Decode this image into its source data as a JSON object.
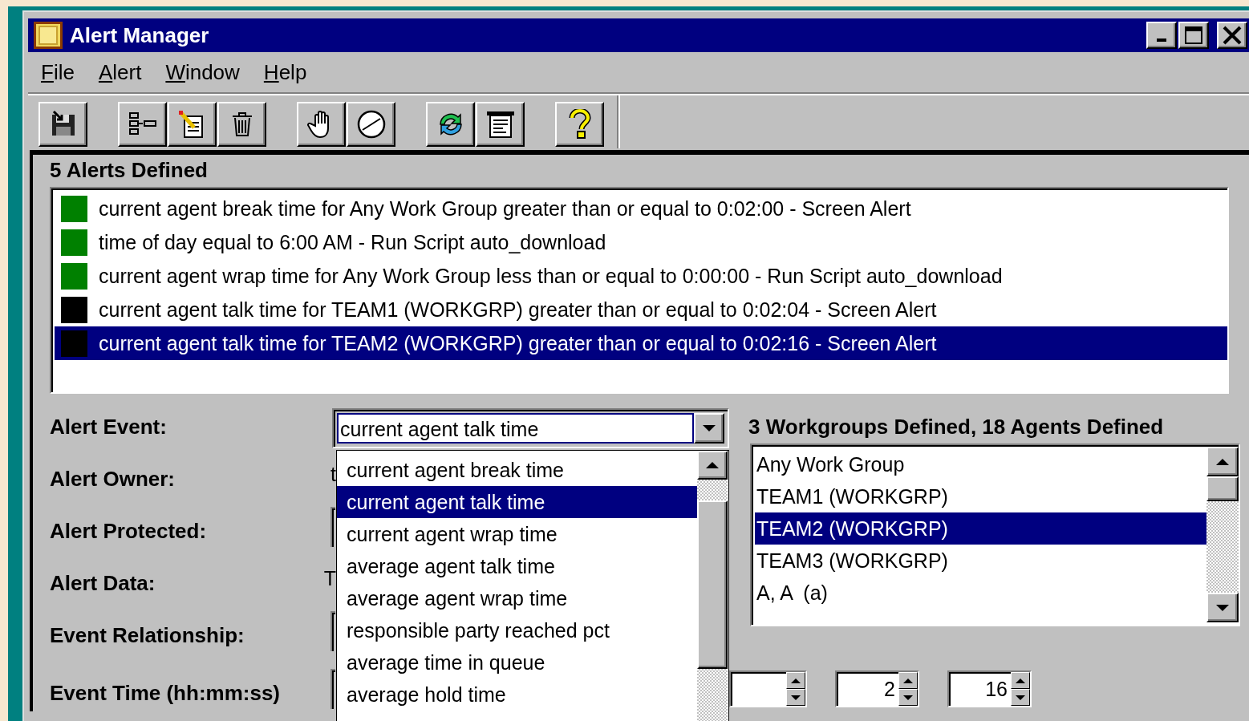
{
  "window": {
    "title": "Alert Manager"
  },
  "menu": [
    "File",
    "Alert",
    "Window",
    "Help"
  ],
  "alerts": {
    "heading": "5 Alerts Defined",
    "items": [
      {
        "text": "current agent break time for Any Work Group greater than or equal to 0:02:00 - Screen Alert",
        "color": "#008000",
        "selected": false
      },
      {
        "text": "time of day equal to 6:00 AM - Run Script auto_download",
        "color": "#008000",
        "selected": false
      },
      {
        "text": "current agent wrap time for Any Work Group less than or equal to 0:00:00 - Run Script auto_download",
        "color": "#008000",
        "selected": false
      },
      {
        "text": "current agent talk time for TEAM1 (WORKGRP) greater than or equal to 0:02:04 - Screen Alert",
        "color": "#000000",
        "selected": false
      },
      {
        "text": "current agent talk time for TEAM2 (WORKGRP) greater than or equal to 0:02:16 - Screen Alert",
        "color": "#000000",
        "selected": true
      }
    ]
  },
  "form": {
    "fields": [
      {
        "label": "Alert Event:",
        "kind": "combo",
        "value": "current agent talk time"
      },
      {
        "label": "Alert Owner:",
        "kind": "text",
        "value": "t"
      },
      {
        "label": "Alert Protected:",
        "kind": "box"
      },
      {
        "label": "Alert Data:",
        "kind": "text",
        "value": "T"
      },
      {
        "label": "Event Relationship:",
        "kind": "box"
      },
      {
        "label": "Event Time (hh:mm:ss)",
        "kind": "box"
      }
    ]
  },
  "dropdown": {
    "items": [
      {
        "label": "current agent break time",
        "selected": false
      },
      {
        "label": "current agent talk time",
        "selected": true
      },
      {
        "label": "current agent wrap time",
        "selected": false
      },
      {
        "label": "average agent talk time",
        "selected": false
      },
      {
        "label": "average agent wrap time",
        "selected": false
      },
      {
        "label": "responsible party reached pct",
        "selected": false
      },
      {
        "label": "average time in queue",
        "selected": false
      },
      {
        "label": "average hold time",
        "selected": false
      }
    ]
  },
  "workgroups": {
    "heading": "3 Workgroups Defined, 18 Agents Defined",
    "items": [
      {
        "label": "Any Work Group",
        "selected": false
      },
      {
        "label": "TEAM1 (WORKGRP)",
        "selected": false
      },
      {
        "label": "TEAM2 (WORKGRP)",
        "selected": true
      },
      {
        "label": "TEAM3 (WORKGRP)",
        "selected": false
      },
      {
        "label": "A, A  (a)",
        "selected": false
      }
    ]
  },
  "time_spinners": [
    {
      "kind": "hours"
    },
    {
      "kind": "minutes",
      "value": "2"
    },
    {
      "kind": "seconds",
      "value": "16"
    }
  ]
}
